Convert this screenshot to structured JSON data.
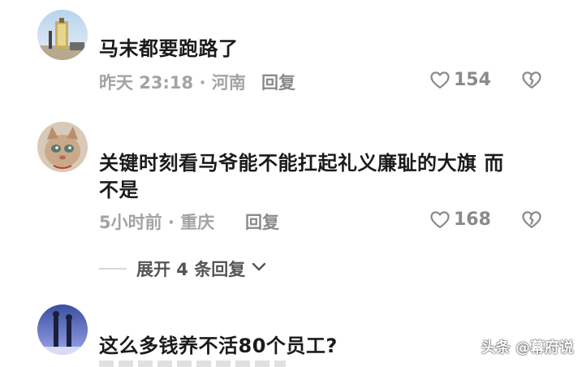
{
  "comments": [
    {
      "text": "马末都要跑路了",
      "meta": "昨天 23:18 · 河南",
      "reply_label": "回复",
      "likes": "154"
    },
    {
      "text": "关键时刻看马爷能不能扛起礼义廉耻的大旗 而不是",
      "meta": "5小时前 · 重庆",
      "reply_label": "回复",
      "likes": "168",
      "expand_label": "展开 4 条回复"
    },
    {
      "text": "这么多钱养不活80个员工?"
    }
  ],
  "watermark": "头条 @幕府说",
  "icons": {
    "like": "heart-outline-icon",
    "dislike": "broken-heart-icon",
    "expand": "chevron-down-icon"
  },
  "colors": {
    "text": "#1b1b1b",
    "meta": "#a3a3a3",
    "action": "#8a8a8a"
  }
}
